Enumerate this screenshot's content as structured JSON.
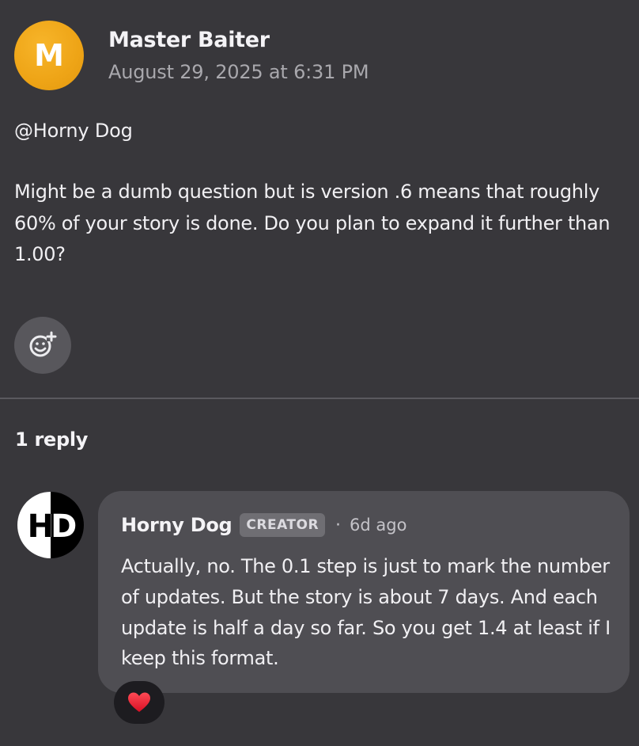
{
  "post": {
    "author_initial": "M",
    "author_name": "Master Baiter",
    "date": "August 29, 2025 at 6:31 PM",
    "mention": "@Horny Dog",
    "body": "Might be a dumb question but is version .6 means that roughly 60% of your story is done. Do you plan to expand it further than 1.00?",
    "react_icon": "add-emoji-icon"
  },
  "replies": {
    "count_label": "1 reply",
    "items": [
      {
        "avatar_text": "HD",
        "author": "Horny Dog",
        "badge": "CREATOR",
        "separator": "·",
        "time": "6d ago",
        "body": "Actually, no. The 0.1 step is just to mark the number of updates. But the story is about 7 days. And each update is half a day so far. So you get 1.4 at least if I keep this format.",
        "reaction_icon": "heart-icon",
        "reaction_color": "#e5152b"
      }
    ]
  },
  "colors": {
    "background": "#38373b",
    "avatar_orange": "#eea416",
    "reply_bubble": "#4f4e53"
  }
}
